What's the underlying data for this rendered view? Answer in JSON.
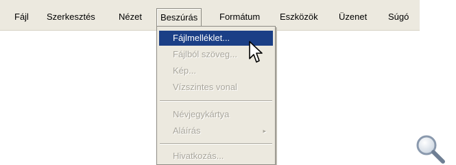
{
  "menubar": {
    "items": [
      {
        "label": "Fájl"
      },
      {
        "label": "Szerkesztés"
      },
      {
        "label": "Nézet"
      },
      {
        "label": "Beszúrás"
      },
      {
        "label": "Formátum"
      },
      {
        "label": "Eszközök"
      },
      {
        "label": "Üzenet"
      },
      {
        "label": "Súgó"
      }
    ]
  },
  "insert_menu": {
    "items": [
      {
        "label": "Fájlmelléklet...",
        "state": "highlighted"
      },
      {
        "label": "Fájlból szöveg...",
        "state": "disabled"
      },
      {
        "label": "Kép...",
        "state": "disabled"
      },
      {
        "label": "Vízszintes vonal",
        "state": "disabled"
      },
      {
        "label": "Névjegykártya",
        "state": "disabled"
      },
      {
        "label": "Aláírás",
        "state": "disabled",
        "submenu": true
      },
      {
        "label": "Hivatkozás...",
        "state": "disabled"
      }
    ],
    "submenu_glyph": "▸"
  },
  "icons": {
    "cursor": "mouse-pointer-icon",
    "zoom": "magnifier-icon"
  },
  "colors": {
    "menu_bg": "#ece9df",
    "highlight_bg": "#1b3f86",
    "disabled_text": "#a9a69c"
  }
}
